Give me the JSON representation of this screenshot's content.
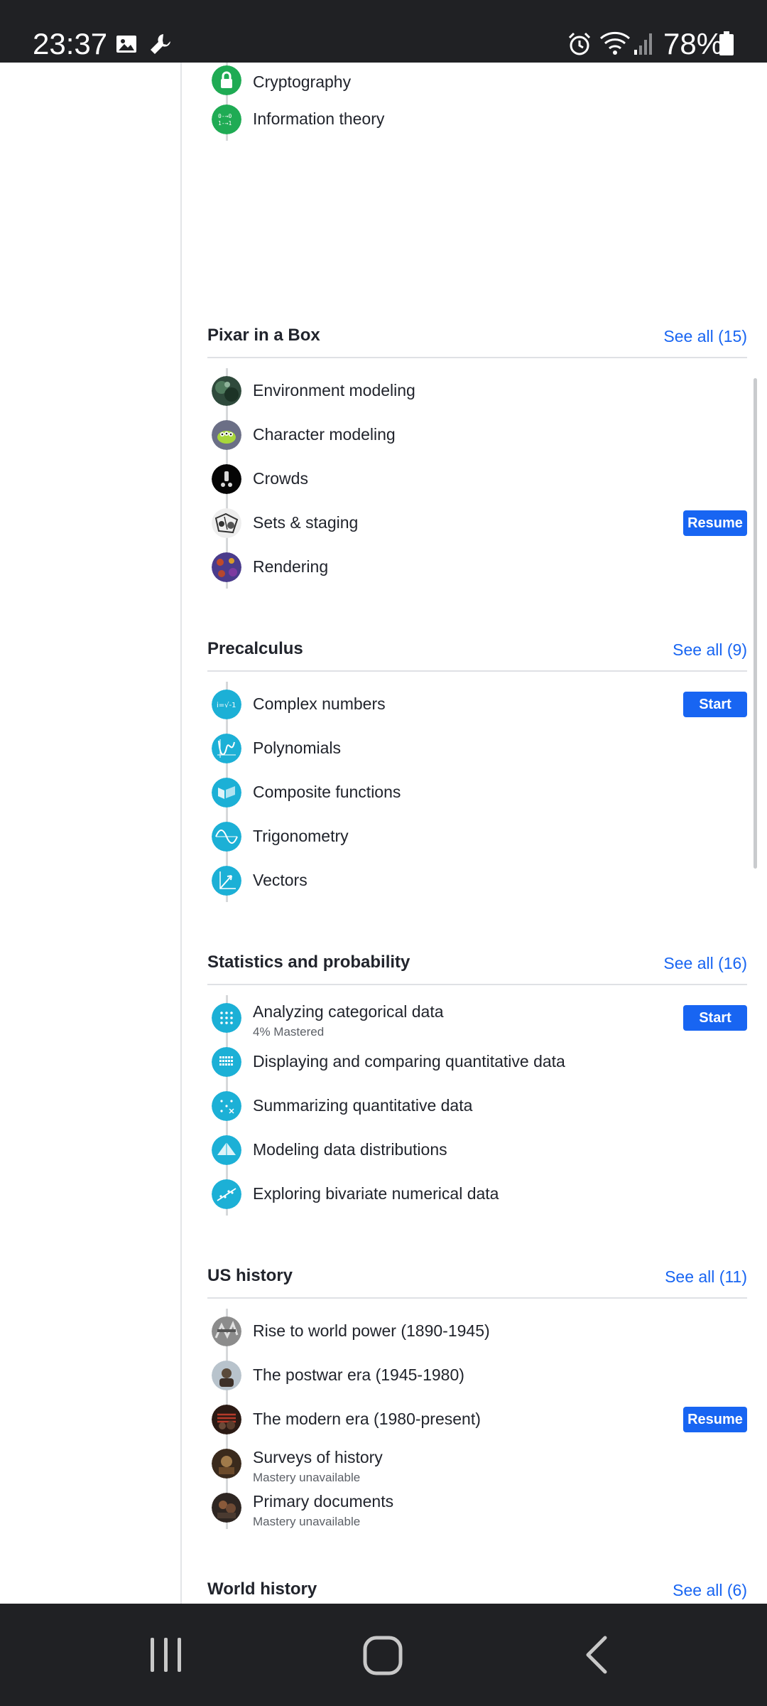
{
  "status_bar": {
    "time": "23:37",
    "battery": "78%",
    "icons": [
      "image-icon",
      "wrench-icon",
      "alarm-icon",
      "wifi-icon",
      "signal-icon",
      "battery-icon"
    ]
  },
  "top_section": {
    "units": [
      {
        "title": "Cryptography",
        "icon": "lock-icon",
        "color": "#1fab54"
      },
      {
        "title": "Information theory",
        "icon": "binary-icon",
        "color": "#1fab54"
      }
    ]
  },
  "sections": [
    {
      "title": "Pixar in a Box",
      "see_all": "See all (15)",
      "units": [
        {
          "title": "Environment modeling",
          "icon": "environment-thumbnail"
        },
        {
          "title": "Character modeling",
          "icon": "character-thumbnail"
        },
        {
          "title": "Crowds",
          "icon": "crowds-thumbnail"
        },
        {
          "title": "Sets & staging",
          "icon": "sets-thumbnail",
          "action": "Resume"
        },
        {
          "title": "Rendering",
          "icon": "rendering-thumbnail"
        }
      ]
    },
    {
      "title": "Precalculus",
      "see_all": "See all (9)",
      "units": [
        {
          "title": "Complex numbers",
          "icon": "complex-numbers-icon",
          "action": "Start"
        },
        {
          "title": "Polynomials",
          "icon": "polynomials-icon"
        },
        {
          "title": "Composite functions",
          "icon": "composite-functions-icon"
        },
        {
          "title": "Trigonometry",
          "icon": "trigonometry-icon"
        },
        {
          "title": "Vectors",
          "icon": "vectors-icon"
        }
      ]
    },
    {
      "title": "Statistics and probability",
      "see_all": "See all (16)",
      "units": [
        {
          "title": "Analyzing categorical data",
          "subtitle": "4% Mastered",
          "icon": "categorical-data-icon",
          "action": "Start"
        },
        {
          "title": "Displaying and comparing quantitative data",
          "icon": "quantitative-data-icon"
        },
        {
          "title": "Summarizing quantitative data",
          "icon": "summarizing-data-icon"
        },
        {
          "title": "Modeling data distributions",
          "icon": "distributions-icon"
        },
        {
          "title": "Exploring bivariate numerical data",
          "icon": "bivariate-data-icon"
        }
      ]
    },
    {
      "title": "US history",
      "see_all": "See all (11)",
      "units": [
        {
          "title": "Rise to world power (1890-1945)",
          "icon": "world-power-thumbnail"
        },
        {
          "title": "The postwar era (1945-1980)",
          "icon": "postwar-thumbnail"
        },
        {
          "title": "The modern era (1980-present)",
          "icon": "modern-era-thumbnail",
          "action": "Resume"
        },
        {
          "title": "Surveys of history",
          "subtitle": "Mastery unavailable",
          "icon": "surveys-thumbnail"
        },
        {
          "title": "Primary documents",
          "subtitle": "Mastery unavailable",
          "icon": "primary-documents-thumbnail"
        }
      ]
    },
    {
      "title": "World history",
      "see_all": "See all (6)",
      "units": []
    }
  ],
  "colors": {
    "accent": "#1865f2",
    "math_teal": "#14bf96",
    "math_blue": "#1cb0d6",
    "computing_green": "#1fab54"
  }
}
